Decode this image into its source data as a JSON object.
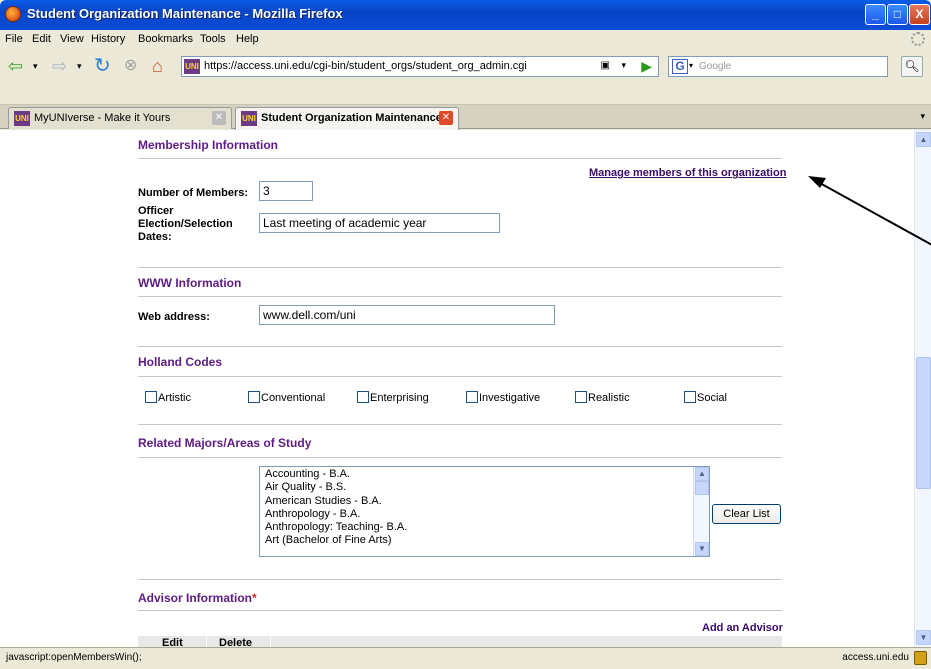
{
  "window": {
    "title": "Student Organization Maintenance - Mozilla Firefox",
    "controls": {
      "minimize": "_",
      "maximize": "□",
      "close": "X"
    }
  },
  "menu": [
    "File",
    "Edit",
    "View",
    "History",
    "Bookmarks",
    "Tools",
    "Help"
  ],
  "nav": {
    "url": "https://access.uni.edu/cgi-bin/student_orgs/student_org_admin.cgi",
    "search_placeholder": "Google",
    "favicon_text": "UNI"
  },
  "tabs": [
    {
      "label": "MyUNIverse - Make it Yours",
      "active": false
    },
    {
      "label": "Student Organization Maintenance",
      "active": true
    }
  ],
  "membership": {
    "title": "Membership Information",
    "manage_link": "Manage members of this organization",
    "members_label": "Number of Members:",
    "members_value": "3",
    "election_label_1": "Officer",
    "election_label_2": "Election/Selection",
    "election_label_3": "Dates:",
    "election_value": "Last meeting of academic year"
  },
  "www": {
    "title": "WWW Information",
    "web_label": "Web address:",
    "web_value": "www.dell.com/uni"
  },
  "holland": {
    "title": "Holland Codes",
    "codes": [
      "Artistic",
      "Conventional",
      "Enterprising",
      "Investigative",
      "Realistic",
      "Social"
    ]
  },
  "majors": {
    "title": "Related Majors/Areas of Study",
    "items": [
      "Accounting - B.A.",
      "Air Quality - B.S.",
      "American Studies - B.A.",
      "Anthropology - B.A.",
      "Anthropology: Teaching- B.A.",
      "Art (Bachelor of Fine Arts)"
    ],
    "clear_button": "Clear List"
  },
  "advisor": {
    "title": "Advisor Information",
    "required_mark": "*",
    "add_link": "Add an Advisor",
    "col_edit": "Edit",
    "col_delete": "Delete"
  },
  "status": {
    "message": "javascript:openMembersWin();",
    "domain": "access.uni.edu"
  },
  "colors": {
    "section_heading": "#5D1C83",
    "link": "#3A0A66",
    "titlebar": "#0844C6"
  }
}
